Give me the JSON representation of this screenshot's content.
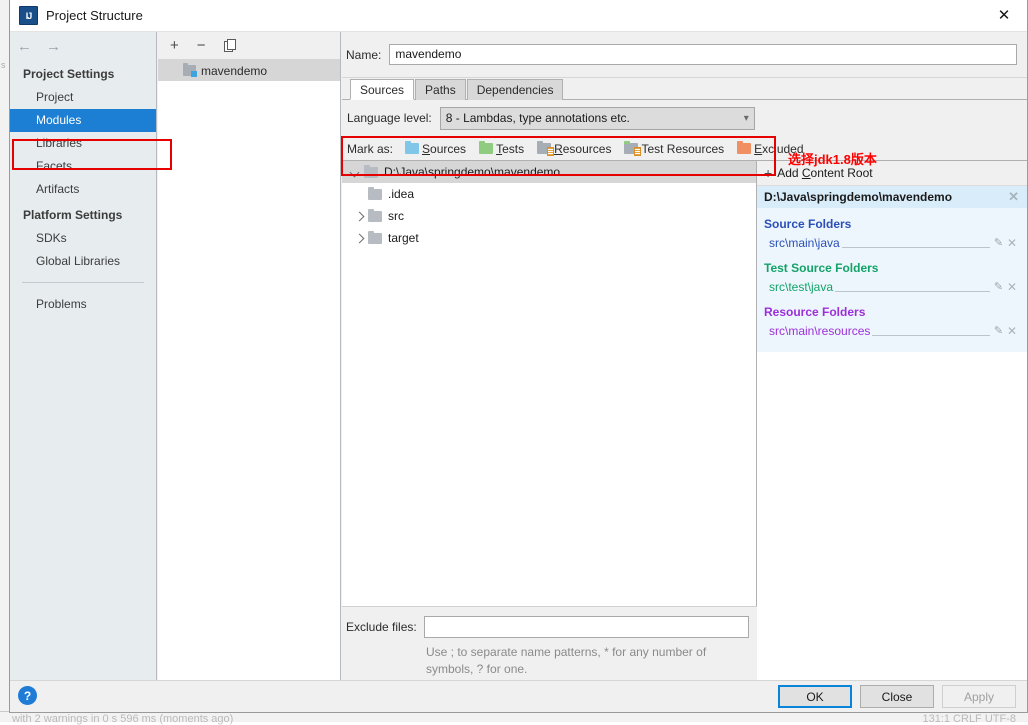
{
  "window": {
    "title": "Project Structure",
    "app_icon": "intellij-idea-icon",
    "close_label": "✕"
  },
  "sidebar": {
    "back_arrow": "←",
    "forward_arrow": "→",
    "sections": [
      {
        "heading": "Project Settings",
        "items": [
          {
            "label": "Project",
            "selected": false
          },
          {
            "label": "Modules",
            "selected": true
          },
          {
            "label": "Libraries",
            "selected": false
          },
          {
            "label": "Facets",
            "selected": false
          },
          {
            "label": "Artifacts",
            "selected": false
          }
        ]
      },
      {
        "heading": "Platform Settings",
        "items": [
          {
            "label": "SDKs",
            "selected": false
          },
          {
            "label": "Global Libraries",
            "selected": false
          }
        ]
      }
    ],
    "problems": "Problems"
  },
  "modules_panel": {
    "toolbar": {
      "add": "+",
      "remove": "−",
      "copy": "copy-icon"
    },
    "items": [
      {
        "label": "mavendemo",
        "selected": true
      }
    ]
  },
  "main": {
    "name": {
      "label": "Name:",
      "value": "mavendemo",
      "placeholder": ""
    },
    "tabs": [
      {
        "label": "Sources",
        "active": true
      },
      {
        "label": "Paths",
        "active": false
      },
      {
        "label": "Dependencies",
        "active": false
      }
    ],
    "language_level": {
      "label": "Language level:",
      "value": "8 - Lambdas, type annotations etc.",
      "arrow": "⌄"
    },
    "mark_as": {
      "label": "Mark as:",
      "options": [
        {
          "label": "Sources",
          "mnemonic": "S",
          "rest": "ources",
          "kind": "sources"
        },
        {
          "label": "Tests",
          "mnemonic": "T",
          "rest": "ests",
          "kind": "tests"
        },
        {
          "label": "Resources",
          "mnemonic": "R",
          "rest": "esources",
          "kind": "resources"
        },
        {
          "label": "Test Resources",
          "mnemonic": "",
          "rest": "Test Resources",
          "kind": "testres"
        },
        {
          "label": "Excluded",
          "mnemonic": "E",
          "rest": "xcluded",
          "kind": "excluded"
        }
      ]
    },
    "tree": [
      {
        "label": "D:\\Java\\springdemo\\mavendemo",
        "indent": 0,
        "twisty": "down",
        "selected": true
      },
      {
        "label": ".idea",
        "indent": 1,
        "twisty": "none",
        "selected": false
      },
      {
        "label": "src",
        "indent": 1,
        "twisty": "right",
        "selected": false
      },
      {
        "label": "target",
        "indent": 1,
        "twisty": "right",
        "selected": false
      }
    ],
    "content_roots": {
      "add_label": "Add Content Root",
      "add_mnemonic_prefix": "Add ",
      "add_mnemonic": "C",
      "add_mnemonic_rest": "ontent Root",
      "root_path": "D:\\Java\\springdemo\\mavendemo",
      "close_label": "✕",
      "groups": [
        {
          "title": "Source Folders",
          "kind": "src",
          "paths": [
            "src\\main\\java"
          ]
        },
        {
          "title": "Test Source Folders",
          "kind": "test",
          "paths": [
            "src\\test\\java"
          ]
        },
        {
          "title": "Resource Folders",
          "kind": "res",
          "paths": [
            "src\\main\\resources"
          ]
        }
      ],
      "edit_icon": "✎",
      "remove_icon": "✕"
    },
    "exclude": {
      "label": "Exclude files:",
      "value": "",
      "placeholder": "",
      "hint": "Use ; to separate name patterns, * for any number of symbols, ? for one."
    }
  },
  "annotations": {
    "red_note": "选择jdk1.8版本",
    "red_color": "#ff0000"
  },
  "footer": {
    "help": "?",
    "buttons": [
      {
        "label": "OK",
        "state": "primary"
      },
      {
        "label": "Close",
        "state": "normal"
      },
      {
        "label": "Apply",
        "state": "disabled"
      }
    ]
  },
  "background": {
    "bottom_text": "with 2 warnings in 0 s 596 ms (moments ago)",
    "bottom_right_text": "131:1   CRLF   UTF-8",
    "left_tick": "s"
  },
  "colors": {
    "accent_blue": "#1d7fd4",
    "annotation_red": "#e60000",
    "source_folder": "#2a4fb7",
    "test_folder": "#13a368",
    "resource_folder": "#9b30d9"
  }
}
